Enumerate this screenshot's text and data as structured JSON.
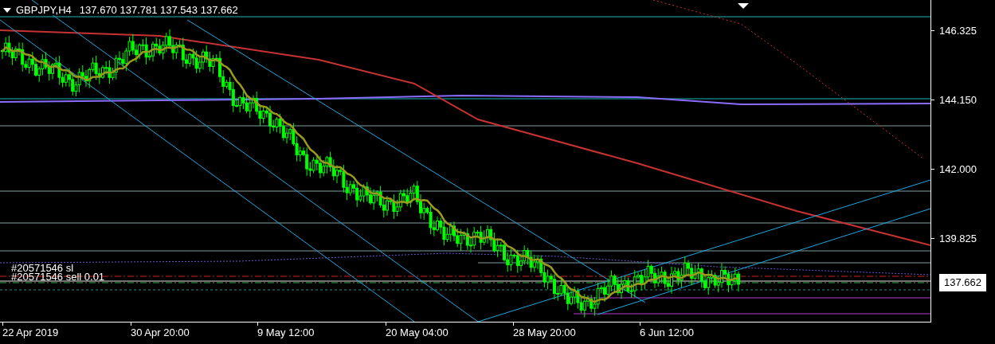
{
  "chart_header": {
    "symbol": "GBPJPY,H4",
    "quotes": "137.670 137.781 137.543 137.662"
  },
  "order_labels": [
    "#20571546 sl",
    "#20571546 sell 0.01"
  ],
  "price_axis": {
    "ticks": [
      "146.325",
      "144.150",
      "142.000",
      "139.825"
    ],
    "current_price": "137.662"
  },
  "time_axis": {
    "labels": [
      "22 Apr 2019",
      "30 Apr 20:00",
      "9 May 12:00",
      "20 May 04:00",
      "28 May 20:00",
      "6 Jun 12:00"
    ]
  }
}
